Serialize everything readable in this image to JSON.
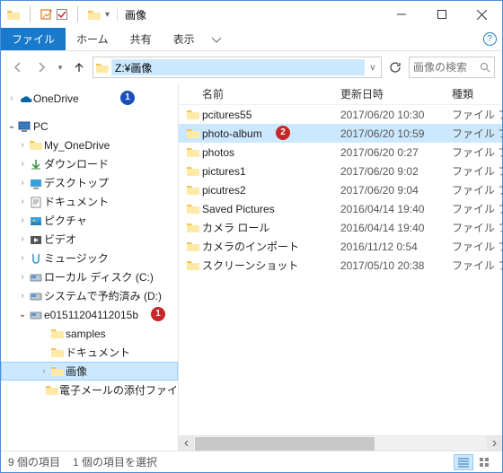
{
  "window": {
    "title": "画像"
  },
  "ribbon": {
    "file": "ファイル",
    "home": "ホーム",
    "share": "共有",
    "view": "表示"
  },
  "nav": {
    "address_value": "Z:¥画像",
    "search_placeholder": "画像の検索"
  },
  "tree": {
    "onedrive": "OneDrive",
    "pc": "PC",
    "items": [
      {
        "label": "My_OneDrive"
      },
      {
        "label": "ダウンロード"
      },
      {
        "label": "デスクトップ"
      },
      {
        "label": "ドキュメント"
      },
      {
        "label": "ピクチャ"
      },
      {
        "label": "ビデオ"
      },
      {
        "label": "ミュージック"
      },
      {
        "label": "ローカル ディスク (C:)"
      },
      {
        "label": "システムで予約済み (D:)"
      },
      {
        "label": "e01511204112015b"
      }
    ],
    "sub": [
      {
        "label": "samples"
      },
      {
        "label": "ドキュメント"
      },
      {
        "label": "画像"
      },
      {
        "label": "電子メールの添付ファイ"
      }
    ]
  },
  "columns": {
    "name": "名前",
    "date": "更新日時",
    "type": "種類"
  },
  "files": [
    {
      "name": "pcitures55",
      "date": "2017/06/20 10:30",
      "type": "ファイル フォル"
    },
    {
      "name": "photo-album",
      "date": "2017/06/20 10:59",
      "type": "ファイル フォル"
    },
    {
      "name": "photos",
      "date": "2017/06/20 0:27",
      "type": "ファイル フォル"
    },
    {
      "name": "pictures1",
      "date": "2017/06/20 9:02",
      "type": "ファイル フォル"
    },
    {
      "name": "picutres2",
      "date": "2017/06/20 9:04",
      "type": "ファイル フォル"
    },
    {
      "name": "Saved Pictures",
      "date": "2016/04/14 19:40",
      "type": "ファイル フォル"
    },
    {
      "name": "カメラ ロール",
      "date": "2016/04/14 19:40",
      "type": "ファイル フォル"
    },
    {
      "name": "カメラのインポート",
      "date": "2016/11/12 0:54",
      "type": "ファイル フォル"
    },
    {
      "name": "スクリーンショット",
      "date": "2017/05/10 20:38",
      "type": "ファイル フォル"
    }
  ],
  "status": {
    "count": "9 個の項目",
    "selected": "1 個の項目を選択"
  },
  "badges": {
    "one": "1",
    "one_red": "1",
    "two": "2"
  }
}
